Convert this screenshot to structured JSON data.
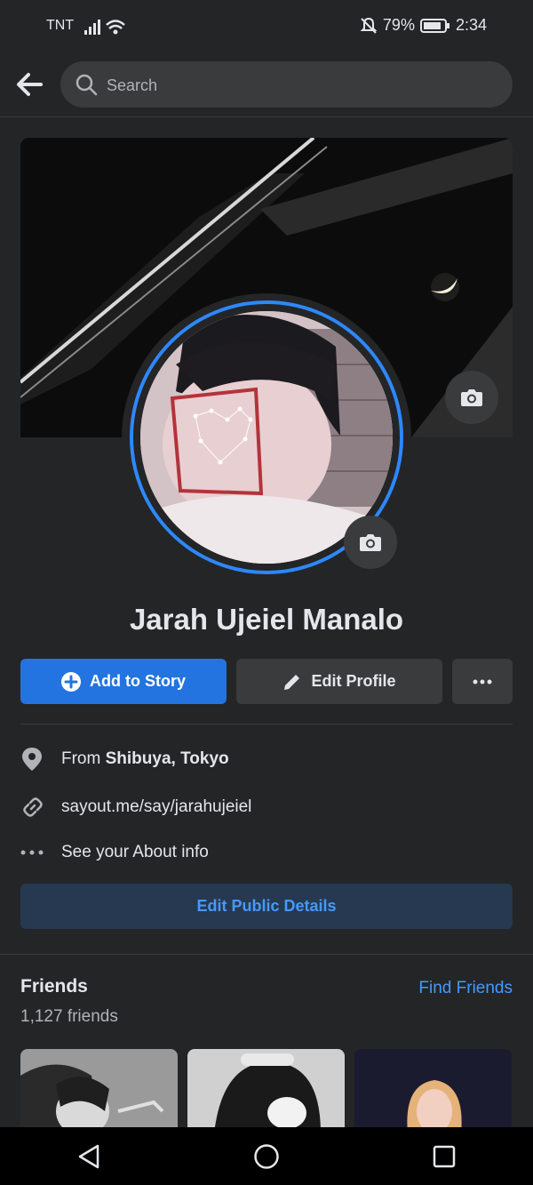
{
  "status_bar": {
    "carrier": "TNT",
    "battery": "79%",
    "time": "2:34",
    "icons": [
      "signal-icon",
      "wifi-icon",
      "bell-off-icon",
      "battery-icon"
    ]
  },
  "header": {
    "search_placeholder": "Search"
  },
  "profile": {
    "name": "Jarah Ujeiel Manalo"
  },
  "actions": {
    "add_story": "Add to Story",
    "edit_profile": "Edit Profile",
    "more": "..."
  },
  "details": {
    "from_prefix": "From ",
    "from_place": "Shibuya, Tokyo",
    "link": "sayout.me/say/jarahujeiel",
    "about": "See your About info",
    "edit_public": "Edit Public Details"
  },
  "friends": {
    "title": "Friends",
    "find": "Find Friends",
    "count": "1,127 friends"
  },
  "colors": {
    "background": "#242526",
    "accent": "#2374e1",
    "link": "#4599ff",
    "muted": "#b0b3b8"
  }
}
